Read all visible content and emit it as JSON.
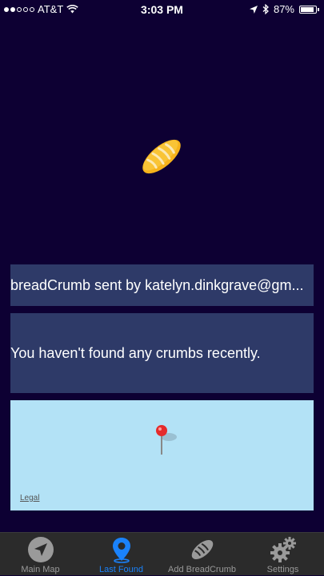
{
  "status_bar": {
    "carrier": "AT&T",
    "time": "3:03 PM",
    "battery_percent": "87%",
    "battery_level": 0.87,
    "signal_bars_filled": 2,
    "signal_bars_total": 5
  },
  "sender_text": "breadCrumb sent by katelyn.dinkgrave@gm...",
  "message_text": "You haven't found any crumbs recently.",
  "map": {
    "legal_label": "Legal"
  },
  "tab_bar": {
    "tabs": [
      {
        "label": "Main Map",
        "icon": "location-arrow-icon",
        "active": false
      },
      {
        "label": "Last Found",
        "icon": "map-pin-icon",
        "active": true
      },
      {
        "label": "Add BreadCrumb",
        "icon": "bread-icon",
        "active": false
      },
      {
        "label": "Settings",
        "icon": "gears-icon",
        "active": false
      }
    ]
  },
  "colors": {
    "background": "#0d0033",
    "panel": "#2e3a68",
    "map": "#b3e2f6",
    "tab_bar": "#2b2b2b",
    "tab_active": "#1a82fb",
    "tab_inactive": "#9a9a9a"
  }
}
